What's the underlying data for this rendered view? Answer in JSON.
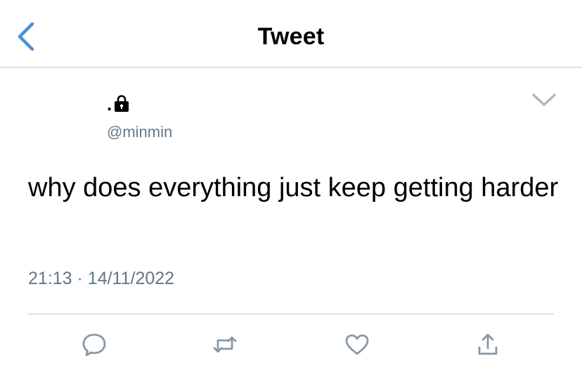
{
  "header": {
    "title": "Tweet",
    "back_icon": "chevron-left-icon"
  },
  "tweet": {
    "display_name": ".",
    "protected_icon": "lock-icon",
    "handle": "@minmin",
    "text": "why does everything just keep getting harder",
    "time": "21:13",
    "separator": "·",
    "date": "14/11/2022",
    "more_icon": "chevron-down-icon"
  },
  "actions": [
    {
      "name": "reply",
      "icon": "speech-bubble-icon"
    },
    {
      "name": "retweet",
      "icon": "retweet-icon"
    },
    {
      "name": "like",
      "icon": "heart-icon"
    },
    {
      "name": "share",
      "icon": "share-icon"
    }
  ],
  "colors": {
    "accent": "#4a90d9",
    "secondary_text": "#657786",
    "action_icon": "#8899a6",
    "divider": "#c8c8cc"
  }
}
